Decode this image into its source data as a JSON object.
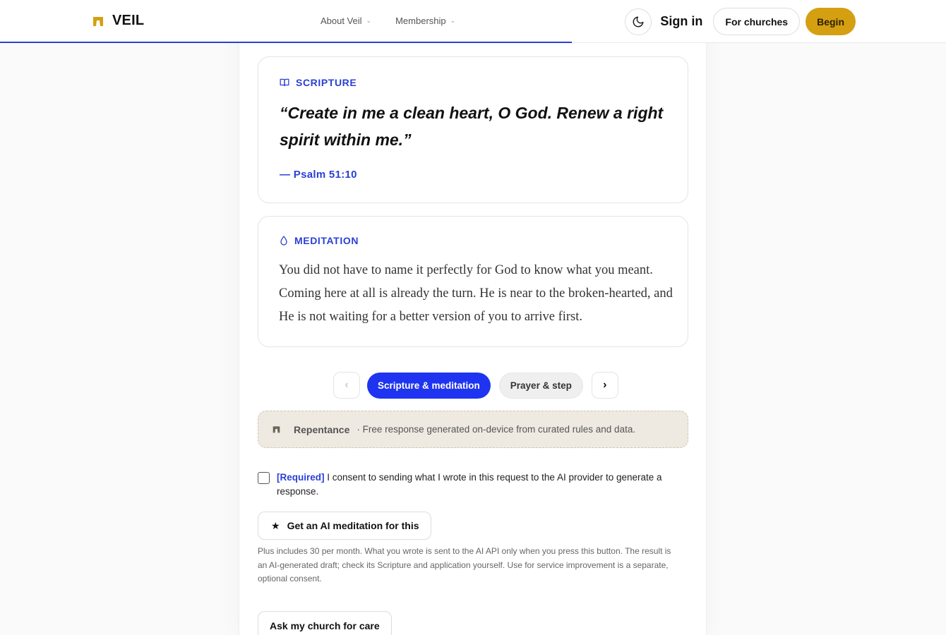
{
  "header": {
    "brand": "VEIL",
    "nav": [
      {
        "label": "About Veil"
      },
      {
        "label": "Membership"
      }
    ],
    "sign_in": "Sign in",
    "for_churches": "For churches",
    "begin": "Begin"
  },
  "scripture": {
    "label": "SCRIPTURE",
    "quote": "“Create in me a clean heart, O God. Renew a right spirit within me.”",
    "reference": "— Psalm 51:10"
  },
  "meditation": {
    "label": "MEDITATION",
    "text": "You did not have to name it perfectly for God to know what you meant. Coming here at all is already the turn. He is near to the broken-hearted, and He is not waiting for a better version of you to arrive first."
  },
  "pager": {
    "prev": "‹",
    "next": "›",
    "tabs": [
      "Scripture & meditation",
      "Prayer & step"
    ]
  },
  "banner": {
    "tag": "Repentance",
    "text": "· Free response generated on-device from curated rules and data."
  },
  "consent": {
    "required": "[Required]",
    "text": " I consent to sending what I wrote in this request to the AI provider to generate a response."
  },
  "ai_button": {
    "label": "Get an AI meditation for this"
  },
  "note": "Plus includes 30 per month. What you wrote is sent to the AI API only when you press this button. The result is an AI-generated draft; check its Scripture and application yourself. Use for service improvement is a separate, optional consent.",
  "care_button": "Ask my church for care",
  "colors": {
    "accent": "#2b3fd6",
    "primary_button": "#1f34f0",
    "gold": "#d4a012",
    "banner_bg": "#efeae1"
  }
}
